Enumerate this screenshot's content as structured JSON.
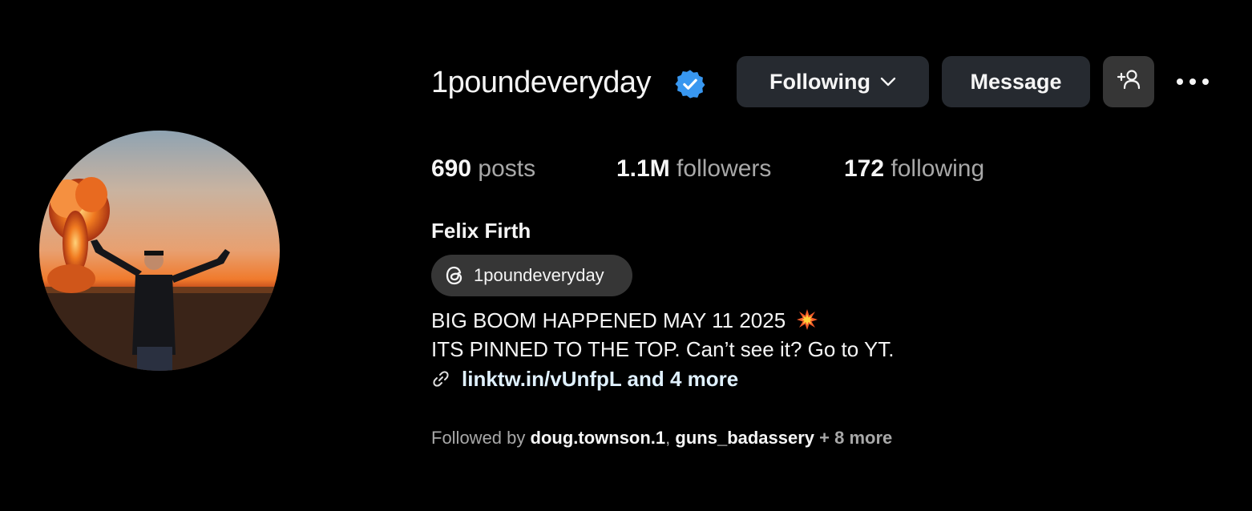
{
  "profile": {
    "username": "1poundeveryday",
    "verified": true,
    "full_name": "Felix Firth",
    "avatar_description": "man with raised arms in front of explosion at sunset"
  },
  "actions": {
    "following_label": "Following",
    "message_label": "Message",
    "add_user_icon": "add-user-icon",
    "more_icon": "more-horizontal-icon"
  },
  "stats": {
    "posts_count": "690",
    "posts_label": "posts",
    "followers_count": "1.1M",
    "followers_label": "followers",
    "following_count": "172",
    "following_label": "following"
  },
  "threads": {
    "handle": "1poundeveryday",
    "icon": "threads-icon"
  },
  "bio": {
    "line1": "BIG BOOM HAPPENED MAY 11 2025",
    "line1_emoji": "collision-emoji",
    "line2": "ITS PINNED TO THE TOP. Can’t see it? Go to YT.",
    "link_text": "linktw.in/vUnfpL and 4 more",
    "link_icon": "link-icon"
  },
  "followed_by": {
    "prefix": "Followed by ",
    "account1": "doug.townson.1",
    "separator": ", ",
    "account2": "guns_badassery",
    "suffix": " + 8 more"
  },
  "colors": {
    "background": "#000000",
    "button": "#262a30",
    "verified": "#3897f0",
    "link": "#e0f1ff",
    "secondary_text": "#a8a8a8"
  }
}
